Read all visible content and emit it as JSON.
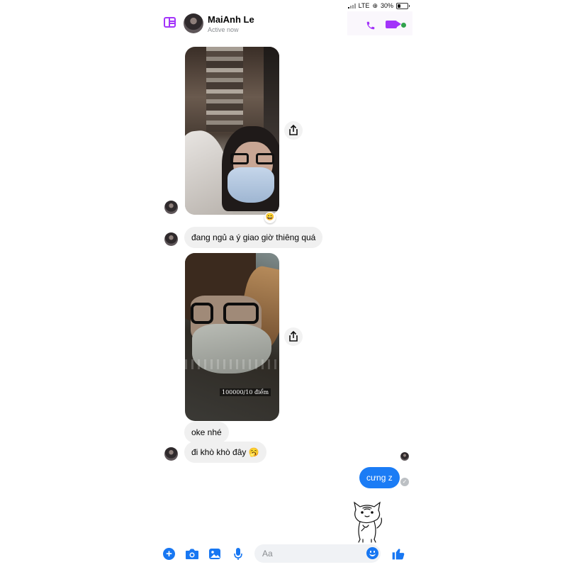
{
  "status_bar": {
    "network": "LTE",
    "battery": "30%",
    "battery_level": 0.3
  },
  "header": {
    "name": "MaiAnh Le",
    "status": "Active now"
  },
  "messages": {
    "reaction_1": "😄",
    "text_1": "đang ngủ a ý giao giờ thiêng quá",
    "photo_2_caption": "100000/10 điểm",
    "text_2": "oke nhé",
    "text_3": "đi khò khò đây 🥱",
    "sent_1": "cưng z"
  },
  "composer": {
    "placeholder": "Aa"
  }
}
